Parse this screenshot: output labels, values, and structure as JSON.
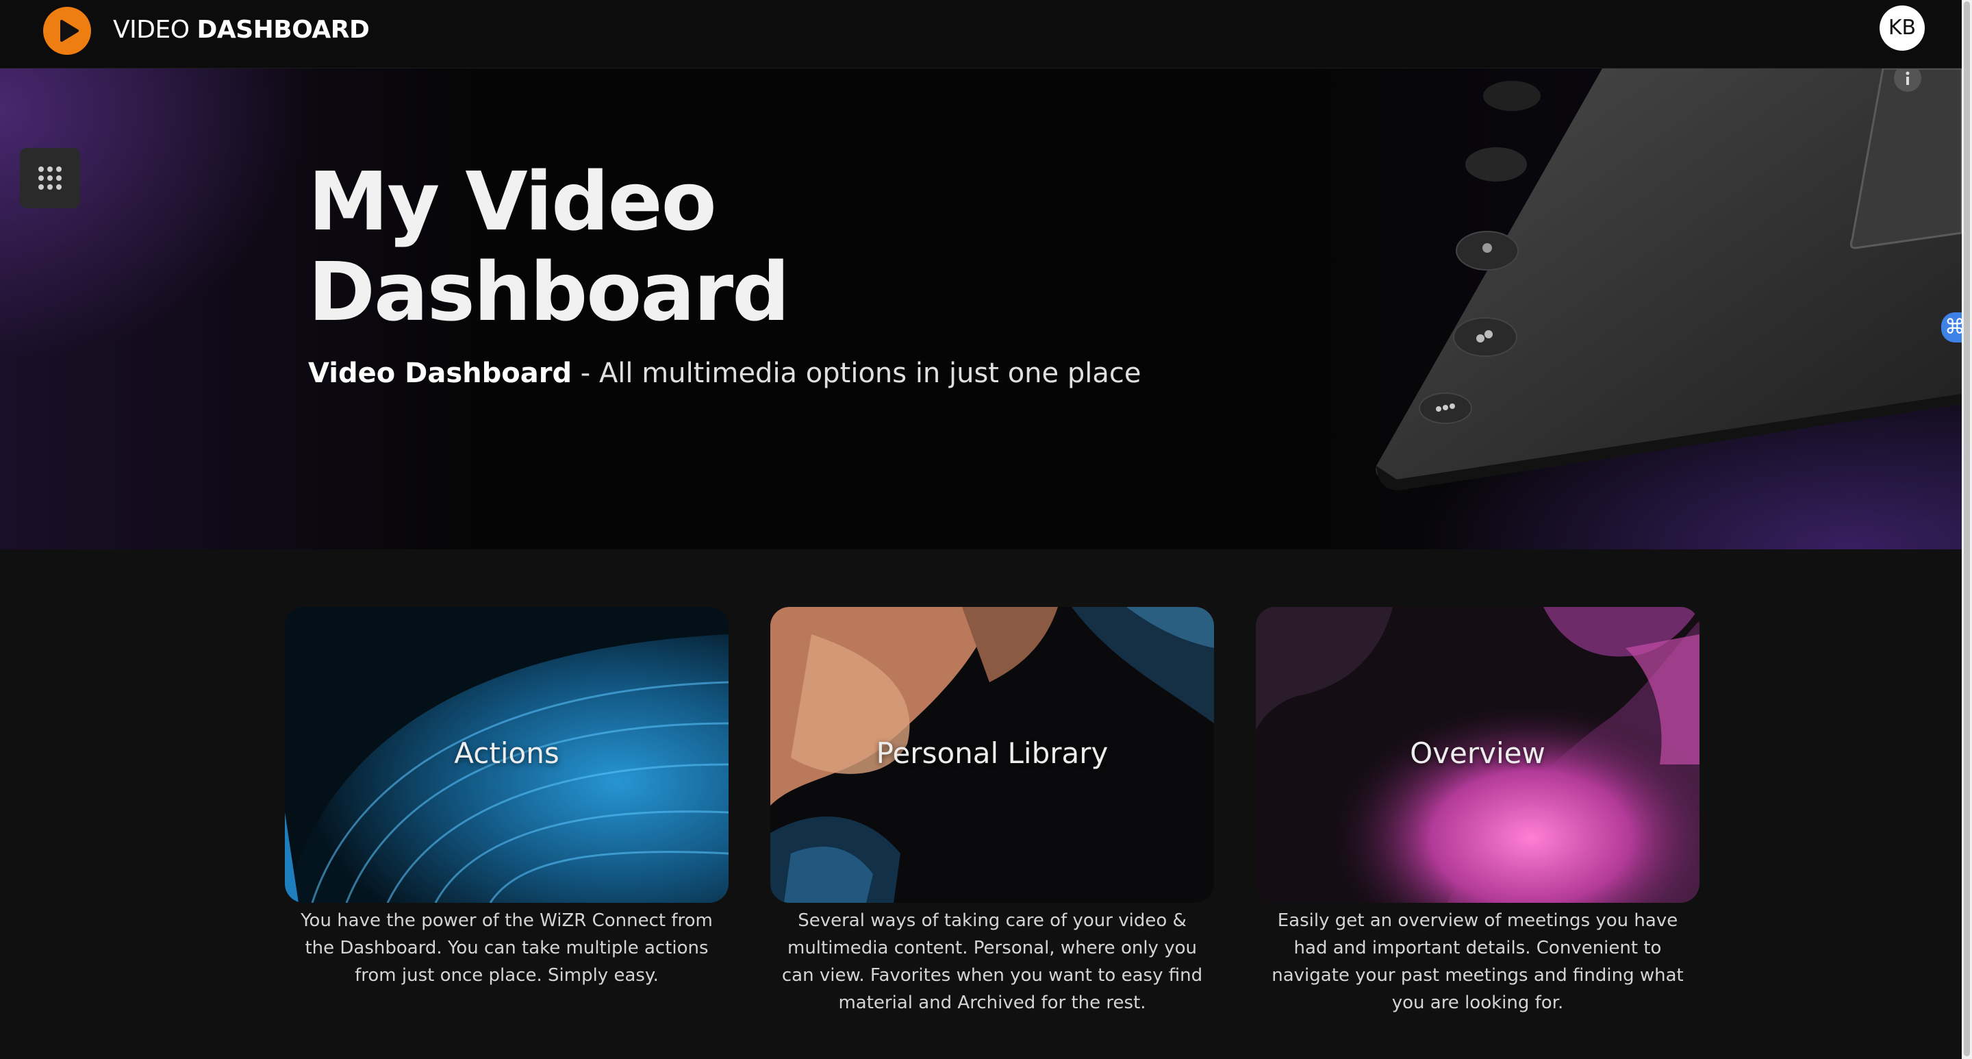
{
  "app": {
    "title_regular": "VIDEO",
    "title_bold": "DASHBOARD",
    "logo_icon": "play-icon",
    "accent_color": "#ee7d12"
  },
  "user": {
    "initials": "KB"
  },
  "hero": {
    "title_line1": "My Video",
    "title_line2": "Dashboard",
    "subtitle_bold": "Video Dashboard",
    "subtitle_rest": " - All multimedia options in just one place",
    "apps_icon": "grid-icon"
  },
  "cards": [
    {
      "title": "Actions",
      "description": "You have the power of the WiZR Connect from the Dashboard. You can take multiple actions from just once place. Simply easy.",
      "theme_color": "#1f8ed3"
    },
    {
      "title": "Personal Library",
      "description": "Several ways of taking care of your video & multimedia content. Personal, where only you can view. Favorites when you want to easy find material and Archived for the rest.",
      "theme_color": "#c98a5e"
    },
    {
      "title": "Overview",
      "description": "Easily get an overview of meetings you have had and important details. Convenient to navigate your past meetings and finding what you are looking for.",
      "theme_color": "#d84fb6"
    }
  ],
  "side_tab": {
    "icon": "command-icon"
  }
}
